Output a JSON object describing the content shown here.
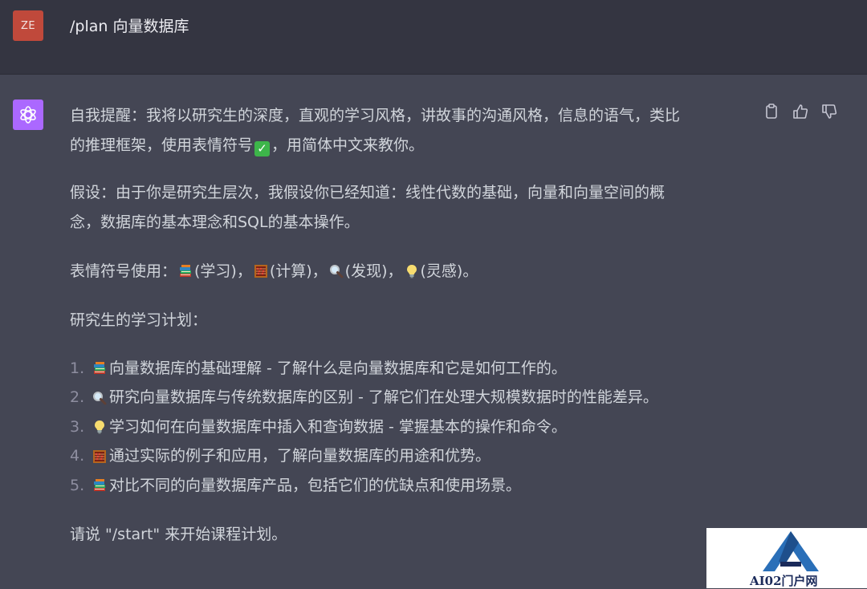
{
  "user": {
    "avatar_initials": "ZE",
    "message": "/plan 向量数据库"
  },
  "assistant": {
    "avatar_icon": "openai-logo-icon",
    "action_icons": [
      "copy-icon",
      "thumbs-up-icon",
      "thumbs-down-icon"
    ],
    "reminder_line1": "自我提醒：我将以研究生的深度，直观的学习风格，讲故事的沟通风格，信息的语气，类比",
    "reminder_line2_a": "的推理框架，使用表情符号",
    "reminder_line2_b": "，用简体中文来教你。",
    "assumption_line1": "假设：由于你是研究生层次，我假设你已经知道：线性代数的基础，向量和向量空间的概",
    "assumption_line2": "念，数据库的基本理念和SQL的基本操作。",
    "emoji_usage": {
      "prefix": "表情符号使用：",
      "study": "(学习)，",
      "compute": "(计算)，",
      "discover": "(发现)，",
      "inspire": "(灵感)。"
    },
    "plan_title": "研究生的学习计划：",
    "plan_items": [
      {
        "num": "1.",
        "icon": "books-icon",
        "text": "向量数据库的基础理解 - 了解什么是向量数据库和它是如何工作的。"
      },
      {
        "num": "2.",
        "icon": "magnifier-icon",
        "text": "研究向量数据库与传统数据库的区别 - 了解它们在处理大规模数据时的性能差异。"
      },
      {
        "num": "3.",
        "icon": "lightbulb-icon",
        "text": "学习如何在向量数据库中插入和查询数据 - 掌握基本的操作和命令。"
      },
      {
        "num": "4.",
        "icon": "abacus-icon",
        "text": "通过实际的例子和应用，了解向量数据库的用途和优势。"
      },
      {
        "num": "5.",
        "icon": "books-icon",
        "text": "对比不同的向量数据库产品，包括它们的优缺点和使用场景。"
      }
    ],
    "closing": "请说 \"/start\" 来开始课程计划。"
  },
  "watermark": {
    "text": "AI02门户网"
  }
}
